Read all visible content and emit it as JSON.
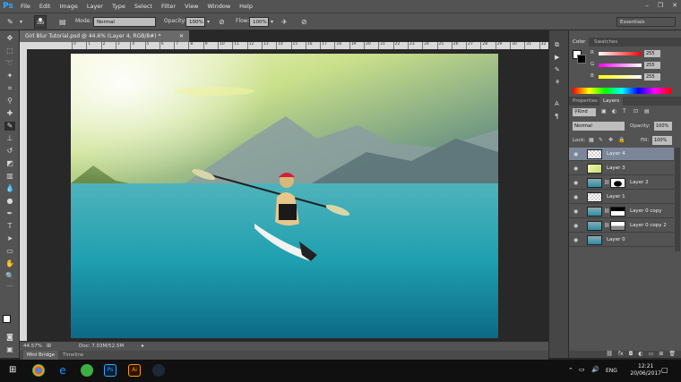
{
  "app": {
    "logo": "Ps"
  },
  "menu": [
    "File",
    "Edit",
    "Image",
    "Layer",
    "Type",
    "Select",
    "Filter",
    "View",
    "Window",
    "Help"
  ],
  "options": {
    "brush_size": "300",
    "mode_label": "Mode:",
    "mode_value": "Normal",
    "opacity_label": "Opacity:",
    "opacity_value": "100%",
    "flow_label": "Flow:",
    "flow_value": "100%",
    "workspace": "Essentials"
  },
  "document": {
    "tab_title": "Girl Blur Tutorial.psd @ 44.6% (Layer 4, RGB/8#) *",
    "zoom": "44.57%",
    "doc_size": "Doc: 7.03M/52.5M"
  },
  "bottom_tabs": {
    "mini_bridge": "Mini Bridge",
    "timeline": "Timeline"
  },
  "ruler_ticks": [
    "0",
    "1",
    "2",
    "3",
    "4",
    "5",
    "6",
    "7",
    "8",
    "9",
    "10",
    "11",
    "12",
    "13",
    "14",
    "15",
    "16",
    "17",
    "18",
    "19",
    "20",
    "21",
    "22",
    "23",
    "24",
    "25",
    "26",
    "27",
    "28",
    "29",
    "30",
    "31",
    "32",
    "33"
  ],
  "color_panel": {
    "tabs": [
      "Color",
      "Swatches"
    ],
    "channels": [
      {
        "label": "R",
        "value": "255",
        "color": "#ff3030"
      },
      {
        "label": "G",
        "value": "255",
        "color": "#30ff30"
      },
      {
        "label": "B",
        "value": "255",
        "color": "#3030ff"
      }
    ]
  },
  "layers_panel": {
    "tabs": [
      "Properties",
      "Layers"
    ],
    "kind": "Kind",
    "blend_mode": "Normal",
    "opacity_label": "Opacity:",
    "opacity_value": "100%",
    "lock_label": "Lock:",
    "fill_label": "Fill:",
    "fill_value": "100%",
    "layers": [
      "Layer 4",
      "Layer 3",
      "Layer 2",
      "Layer 1",
      "Layer 0 copy",
      "Layer 0 copy 2",
      "Layer 0"
    ]
  },
  "taskbar": {
    "language": "ENG",
    "time": "12:21",
    "date": "20/06/2017"
  },
  "colors": {
    "accent": "#31a8ff",
    "selected_layer": "#7b8799"
  }
}
